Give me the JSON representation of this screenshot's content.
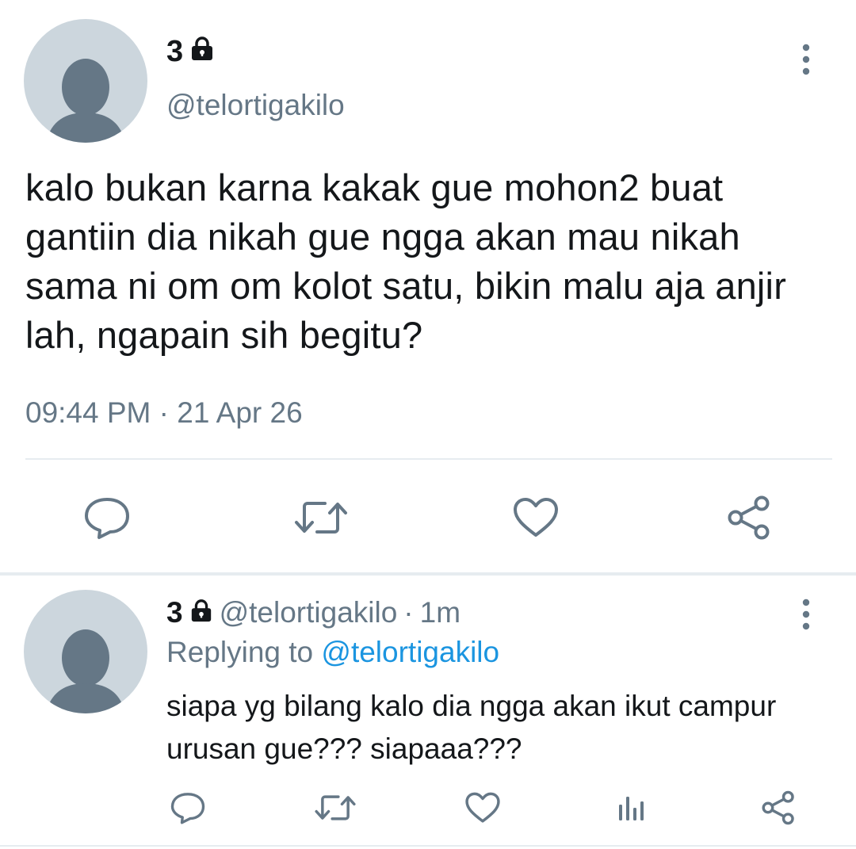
{
  "main_tweet": {
    "display_name": "3",
    "handle": "@telortigakilo",
    "text": "kalo bukan karna kakak gue mohon2 buat gantiin dia nikah gue ngga akan mau nikah sama ni om om kolot satu, bikin malu aja anjir lah, ngapain sih begitu?",
    "timestamp": "09:44 PM · 21 Apr 26",
    "actions": [
      "reply-icon",
      "retweet-icon",
      "like-icon",
      "share-icon"
    ]
  },
  "reply_tweet": {
    "display_name": "3",
    "handle": "@telortigakilo",
    "separator": "·",
    "time": "1m",
    "replying_prefix": "Replying to",
    "replying_to": "@telortigakilo",
    "text": "siapa yg bilang kalo dia ngga akan ikut campur urusan gue??? siapaaa???",
    "actions": [
      "reply-icon",
      "retweet-icon",
      "like-icon",
      "analytics-icon",
      "share-icon"
    ]
  },
  "colors": {
    "text_primary": "#14171a",
    "text_secondary": "#657786",
    "link": "#1b95e0",
    "divider": "#e6ecf0",
    "avatar_bg": "#ccd6dd",
    "avatar_fg": "#657786"
  }
}
